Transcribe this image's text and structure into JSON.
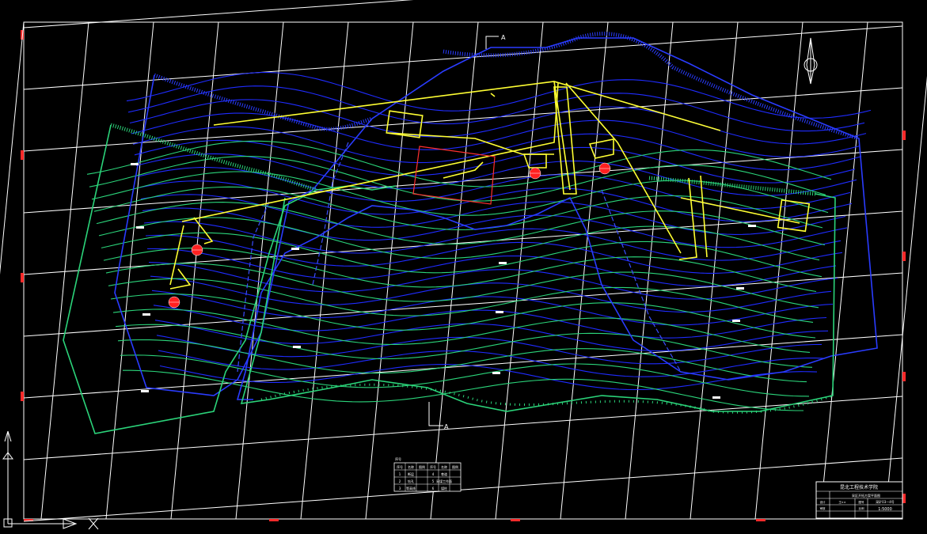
{
  "drawing": {
    "section_marker_top": "A",
    "section_marker_bottom": "A",
    "north_arrow": "north-arrow-icon",
    "ucs_icon": "ucs-axis-icon",
    "title_block": {
      "title": "昆北工程技术学院",
      "drawing_name": "采区开拓方案平面图",
      "row1_label": "设计",
      "row1_value": "王××",
      "row2_label": "审核",
      "row2_value": "",
      "sheet_label": "图号",
      "sheet_value": "采矿03—4号",
      "scale_label": "比例",
      "scale_value": "1:5000"
    },
    "legend_table": {
      "headers": [
        "序号",
        "名称",
        "图例",
        "序号",
        "名称",
        "图例"
      ],
      "rows": [
        [
          "1",
          "断层",
          "",
          "4",
          "巷道",
          ""
        ],
        [
          "2",
          "钻孔",
          "",
          "5",
          "采煤工作面",
          ""
        ],
        [
          "3",
          "等高线",
          "",
          "6",
          "煤柱",
          ""
        ]
      ]
    },
    "colors": {
      "background": "#000000",
      "grid": "#ffffff",
      "contour_green": "#2bd47a",
      "contour_blue": "#1f2cff",
      "workings": "#ffff33",
      "drill_hole": "#ff2020",
      "mining_area": "#ff3030"
    }
  }
}
